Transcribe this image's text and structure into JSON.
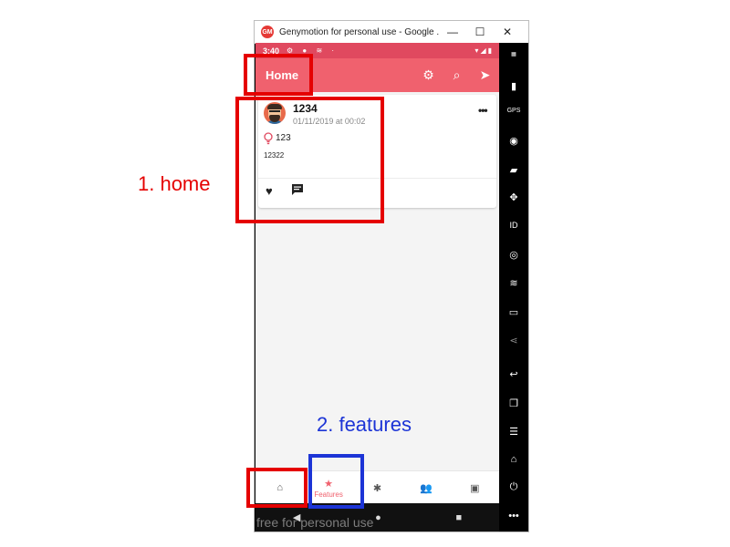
{
  "window": {
    "title": "Genymotion for personal use - Google ...",
    "logo_text": "GM",
    "minimize": "—",
    "maximize": "☐",
    "close": "✕"
  },
  "status_bar": {
    "time": "3:40",
    "left_icons": "⚙ ● ≋ ·",
    "right_icons": "▾◢▮"
  },
  "app_bar": {
    "title": "Home",
    "actions": [
      {
        "icon": "gear-icon",
        "glyph": "⚙"
      },
      {
        "icon": "search-icon",
        "glyph": "⌕"
      },
      {
        "icon": "send-icon",
        "glyph": "➤"
      }
    ]
  },
  "post": {
    "author": "1234",
    "date": "01/11/2019 at 00:02",
    "menu": "•••",
    "topic": "123",
    "body": "12322",
    "like_glyph": "♥"
  },
  "bottom_nav": {
    "items": [
      {
        "name": "home",
        "glyph": "⌂",
        "label": ""
      },
      {
        "name": "features",
        "glyph": "★",
        "label": "Features"
      },
      {
        "name": "explore",
        "glyph": "✱",
        "label": ""
      },
      {
        "name": "people",
        "glyph": "👥",
        "label": ""
      },
      {
        "name": "profile",
        "glyph": "▣",
        "label": ""
      }
    ],
    "active": "features"
  },
  "android_nav": {
    "back": "◀",
    "home": "●",
    "recents": "■"
  },
  "watermark": "free for personal use",
  "side_toolbar": [
    "Open GApps",
    "battery",
    "GPS",
    "camera",
    "capture",
    "dpad",
    "ID",
    "disk",
    "rss",
    "sms",
    "share",
    "back",
    "recents",
    "menu",
    "home",
    "power",
    "more"
  ],
  "annotations": {
    "home_label": "1. home",
    "features_label": "2. features",
    "red": "#e50000",
    "blue": "#1c34d6"
  },
  "colors": {
    "accent": "#f0616e",
    "status": "#e0495f"
  }
}
